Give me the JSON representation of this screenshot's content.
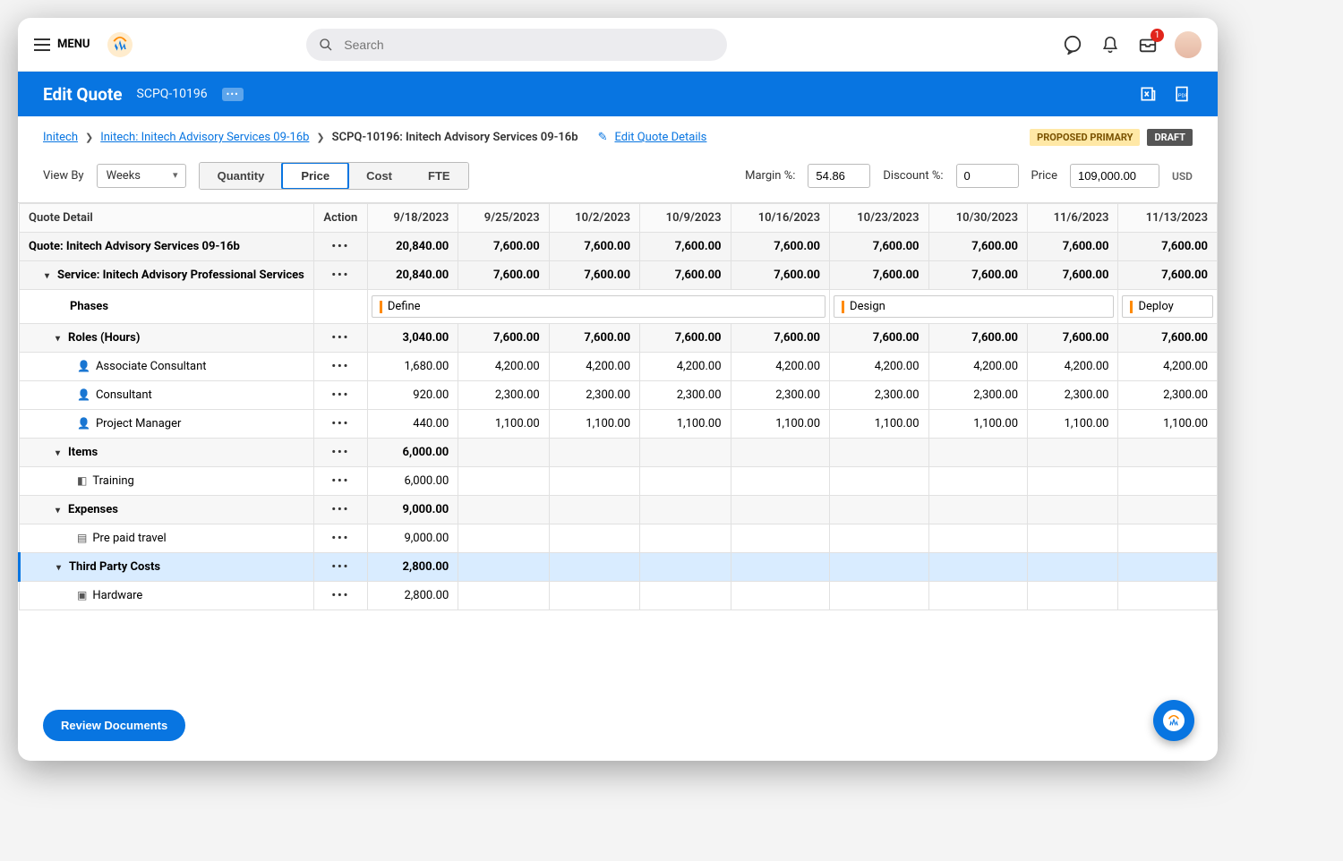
{
  "topbar": {
    "menu": "MENU",
    "search_placeholder": "Search",
    "inbox_badge": "1"
  },
  "header": {
    "title": "Edit Quote",
    "quote_id": "SCPQ-10196"
  },
  "breadcrumb": {
    "root": "Initech",
    "mid": "Initech: Initech Advisory Services 09-16b",
    "leaf": "SCPQ-10196: Initech Advisory Services 09-16b",
    "edit_link": "Edit Quote Details",
    "tag_primary": "PROPOSED PRIMARY",
    "tag_draft": "DRAFT"
  },
  "controls": {
    "view_by_label": "View By",
    "view_by_value": "Weeks",
    "segments": {
      "quantity": "Quantity",
      "price": "Price",
      "cost": "Cost",
      "fte": "FTE"
    },
    "margin_label": "Margin %:",
    "margin_value": "54.86",
    "discount_label": "Discount %:",
    "discount_value": "0",
    "price_label": "Price",
    "price_value": "109,000.00",
    "currency": "USD"
  },
  "table": {
    "col_detail": "Quote Detail",
    "col_action": "Action",
    "dates": [
      "9/18/2023",
      "9/25/2023",
      "10/2/2023",
      "10/9/2023",
      "10/16/2023",
      "10/23/2023",
      "10/30/2023",
      "11/6/2023",
      "11/13/2023"
    ],
    "phases_label": "Phases",
    "phases": {
      "define": "Define",
      "design": "Design",
      "deploy": "Deploy"
    },
    "rows": {
      "quote": {
        "label": "Quote: Initech Advisory Services 09-16b",
        "vals": [
          "20,840.00",
          "7,600.00",
          "7,600.00",
          "7,600.00",
          "7,600.00",
          "7,600.00",
          "7,600.00",
          "7,600.00",
          "7,600.00"
        ]
      },
      "service": {
        "label": "Service: Initech Advisory Professional Services",
        "vals": [
          "20,840.00",
          "7,600.00",
          "7,600.00",
          "7,600.00",
          "7,600.00",
          "7,600.00",
          "7,600.00",
          "7,600.00",
          "7,600.00"
        ]
      },
      "roles": {
        "label": "Roles (Hours)",
        "vals": [
          "3,040.00",
          "7,600.00",
          "7,600.00",
          "7,600.00",
          "7,600.00",
          "7,600.00",
          "7,600.00",
          "7,600.00",
          "7,600.00"
        ]
      },
      "assoc": {
        "label": "Associate Consultant",
        "vals": [
          "1,680.00",
          "4,200.00",
          "4,200.00",
          "4,200.00",
          "4,200.00",
          "4,200.00",
          "4,200.00",
          "4,200.00",
          "4,200.00"
        ]
      },
      "consult": {
        "label": "Consultant",
        "vals": [
          "920.00",
          "2,300.00",
          "2,300.00",
          "2,300.00",
          "2,300.00",
          "2,300.00",
          "2,300.00",
          "2,300.00",
          "2,300.00"
        ]
      },
      "pm": {
        "label": "Project Manager",
        "vals": [
          "440.00",
          "1,100.00",
          "1,100.00",
          "1,100.00",
          "1,100.00",
          "1,100.00",
          "1,100.00",
          "1,100.00",
          "1,100.00"
        ]
      },
      "items": {
        "label": "Items",
        "vals": [
          "6,000.00",
          "",
          "",
          "",
          "",
          "",
          "",
          "",
          ""
        ]
      },
      "training": {
        "label": "Training",
        "vals": [
          "6,000.00",
          "",
          "",
          "",
          "",
          "",
          "",
          "",
          ""
        ]
      },
      "expenses": {
        "label": "Expenses",
        "vals": [
          "9,000.00",
          "",
          "",
          "",
          "",
          "",
          "",
          "",
          ""
        ]
      },
      "travel": {
        "label": "Pre paid travel",
        "vals": [
          "9,000.00",
          "",
          "",
          "",
          "",
          "",
          "",
          "",
          ""
        ]
      },
      "tpc": {
        "label": "Third Party Costs",
        "vals": [
          "2,800.00",
          "",
          "",
          "",
          "",
          "",
          "",
          "",
          ""
        ]
      },
      "hardware": {
        "label": "Hardware",
        "vals": [
          "2,800.00",
          "",
          "",
          "",
          "",
          "",
          "",
          "",
          ""
        ]
      }
    }
  },
  "footer": {
    "review": "Review Documents"
  }
}
